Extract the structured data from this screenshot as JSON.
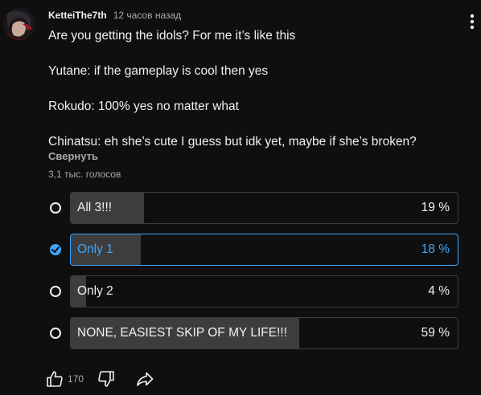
{
  "comment": {
    "author": "KetteiThe7th",
    "time": "12 часов назад",
    "body": [
      "Are you getting the idols? For me it’s like this",
      "Yutane: if the gameplay is cool then yes",
      "Rokudo: 100% yes no matter what",
      "Chinatsu: eh she’s cute I guess but idk yet, maybe if she’s broken?"
    ],
    "collapse_label": "Свернуть"
  },
  "poll": {
    "votes_label": "3,1 тыс. голосов",
    "options": [
      {
        "label": "All 3!!!",
        "percent_text": "19 %",
        "percent": 19,
        "selected": false
      },
      {
        "label": "Only 1",
        "percent_text": "18 %",
        "percent": 18,
        "selected": true
      },
      {
        "label": "Only 2",
        "percent_text": "4 %",
        "percent": 4,
        "selected": false
      },
      {
        "label": "NONE, EASIEST SKIP OF MY LIFE!!!",
        "percent_text": "59 %",
        "percent": 59,
        "selected": false
      }
    ]
  },
  "actions": {
    "like_count": "170"
  },
  "colors": {
    "background": "#0f0f0f",
    "accent": "#3ea6ff",
    "bar_fill": "#3d3d3d",
    "muted_text": "#aaaaaa"
  },
  "icons": [
    "avatar",
    "more-vert-icon",
    "check-icon",
    "thumb-up-icon",
    "thumb-down-icon",
    "share-icon"
  ]
}
